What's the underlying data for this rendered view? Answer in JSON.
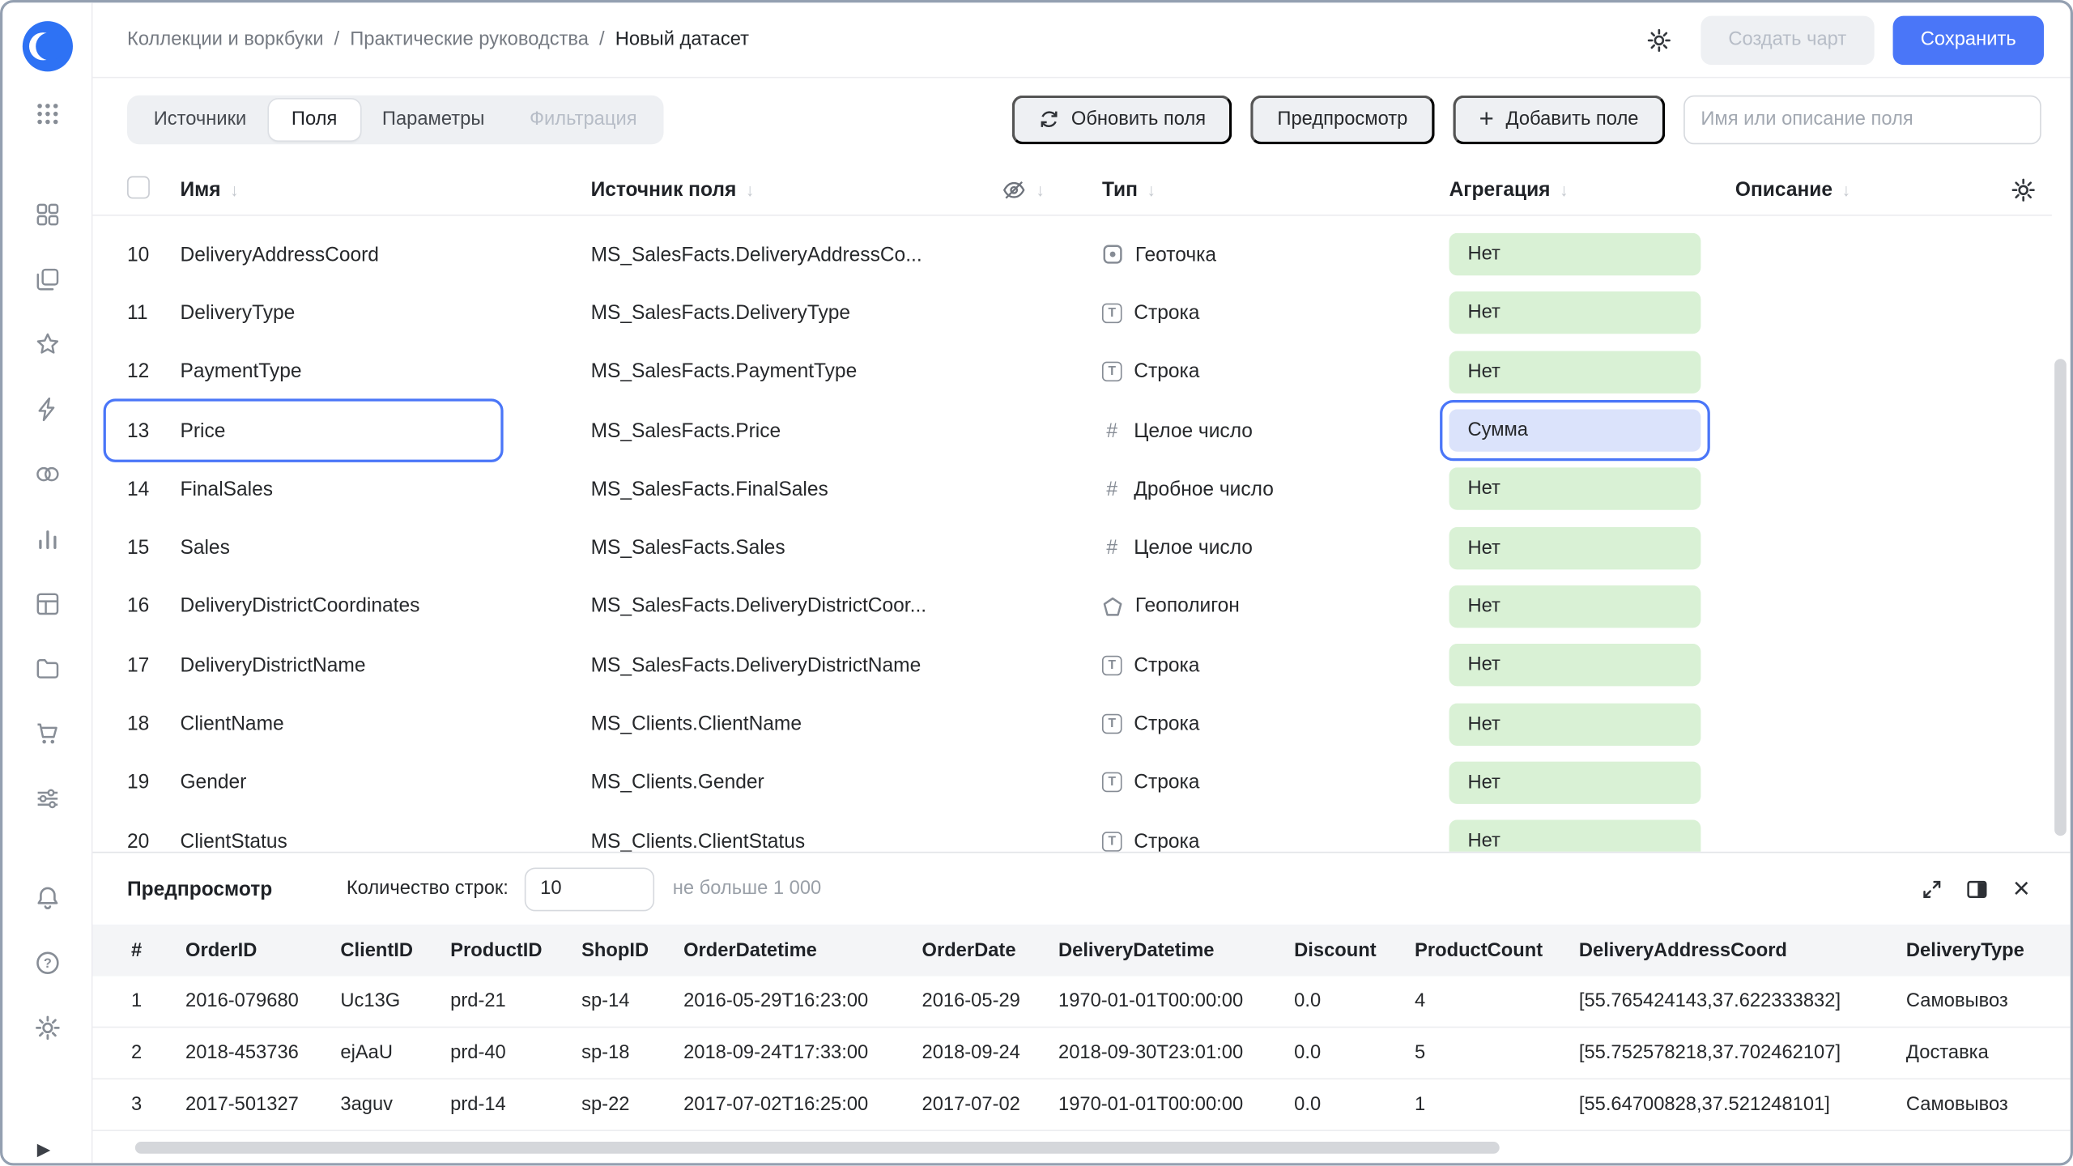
{
  "icons": {
    "gear": "⚙",
    "plus": "+",
    "close": "×",
    "sort_arrow": "↓",
    "play": "▶",
    "separator": "/"
  },
  "colors": {
    "accent_blue": "#4a76f8",
    "badge_green": "#d9f1d5",
    "badge_blue_selected": "#dbe3fb",
    "button_gray": "#eef0f3"
  },
  "header": {
    "breadcrumb": [
      "Коллекции и воркбуки",
      "Практические руководства",
      "Новый датасет"
    ],
    "create_chart": "Создать чарт",
    "save": "Сохранить"
  },
  "toolbar": {
    "tabs": [
      {
        "label": "Источники",
        "state": "default"
      },
      {
        "label": "Поля",
        "state": "active"
      },
      {
        "label": "Параметры",
        "state": "default"
      },
      {
        "label": "Фильтрация",
        "state": "disabled"
      }
    ],
    "refresh_fields": "Обновить поля",
    "preview": "Предпросмотр",
    "add_field": "Добавить поле",
    "search_placeholder": "Имя или описание поля"
  },
  "fields_table": {
    "columns": {
      "name": "Имя",
      "source": "Источник поля",
      "type": "Тип",
      "aggregation": "Агрегация",
      "description": "Описание"
    },
    "rows": [
      {
        "num": "10",
        "name": "DeliveryAddressCoord",
        "source": "MS_SalesFacts.DeliveryAddressCo...",
        "type": "Геоточка",
        "type_kind": "geopoint",
        "aggregation": "Нет",
        "selected": false
      },
      {
        "num": "11",
        "name": "DeliveryType",
        "source": "MS_SalesFacts.DeliveryType",
        "type": "Строка",
        "type_kind": "string",
        "aggregation": "Нет",
        "selected": false
      },
      {
        "num": "12",
        "name": "PaymentType",
        "source": "MS_SalesFacts.PaymentType",
        "type": "Строка",
        "type_kind": "string",
        "aggregation": "Нет",
        "selected": false
      },
      {
        "num": "13",
        "name": "Price",
        "source": "MS_SalesFacts.Price",
        "type": "Целое число",
        "type_kind": "int",
        "aggregation": "Сумма",
        "selected": true
      },
      {
        "num": "14",
        "name": "FinalSales",
        "source": "MS_SalesFacts.FinalSales",
        "type": "Дробное число",
        "type_kind": "float",
        "aggregation": "Нет",
        "selected": false
      },
      {
        "num": "15",
        "name": "Sales",
        "source": "MS_SalesFacts.Sales",
        "type": "Целое число",
        "type_kind": "int",
        "aggregation": "Нет",
        "selected": false
      },
      {
        "num": "16",
        "name": "DeliveryDistrictCoordinates",
        "source": "MS_SalesFacts.DeliveryDistrictCoor...",
        "type": "Геополигон",
        "type_kind": "geopolygon",
        "aggregation": "Нет",
        "selected": false
      },
      {
        "num": "17",
        "name": "DeliveryDistrictName",
        "source": "MS_SalesFacts.DeliveryDistrictName",
        "type": "Строка",
        "type_kind": "string",
        "aggregation": "Нет",
        "selected": false
      },
      {
        "num": "18",
        "name": "ClientName",
        "source": "MS_Clients.ClientName",
        "type": "Строка",
        "type_kind": "string",
        "aggregation": "Нет",
        "selected": false
      },
      {
        "num": "19",
        "name": "Gender",
        "source": "MS_Clients.Gender",
        "type": "Строка",
        "type_kind": "string",
        "aggregation": "Нет",
        "selected": false
      },
      {
        "num": "20",
        "name": "ClientStatus",
        "source": "MS_Clients.ClientStatus",
        "type": "Строка",
        "type_kind": "string",
        "aggregation": "Нет",
        "selected": false
      }
    ]
  },
  "preview_panel": {
    "title": "Предпросмотр",
    "rows_label": "Количество строк:",
    "rows_value": "10",
    "rows_hint": "не больше 1 000",
    "columns": [
      "#",
      "OrderID",
      "ClientID",
      "ProductID",
      "ShopID",
      "OrderDatetime",
      "OrderDate",
      "DeliveryDatetime",
      "Discount",
      "ProductCount",
      "DeliveryAddressCoord",
      "DeliveryType"
    ],
    "rows": [
      [
        "1",
        "2016-079680",
        "Uc13G",
        "prd-21",
        "sp-14",
        "2016-05-29T16:23:00",
        "2016-05-29",
        "1970-01-01T00:00:00",
        "0.0",
        "4",
        "[55.765424143,37.622333832]",
        "Самовывоз"
      ],
      [
        "2",
        "2018-453736",
        "ejAaU",
        "prd-40",
        "sp-18",
        "2018-09-24T17:33:00",
        "2018-09-24",
        "2018-09-30T23:01:00",
        "0.0",
        "5",
        "[55.752578218,37.702462107]",
        "Доставка"
      ],
      [
        "3",
        "2017-501327",
        "3aguv",
        "prd-14",
        "sp-22",
        "2017-07-02T16:25:00",
        "2017-07-02",
        "1970-01-01T00:00:00",
        "0.0",
        "1",
        "[55.64700828,37.521248101]",
        "Самовывоз"
      ]
    ]
  }
}
